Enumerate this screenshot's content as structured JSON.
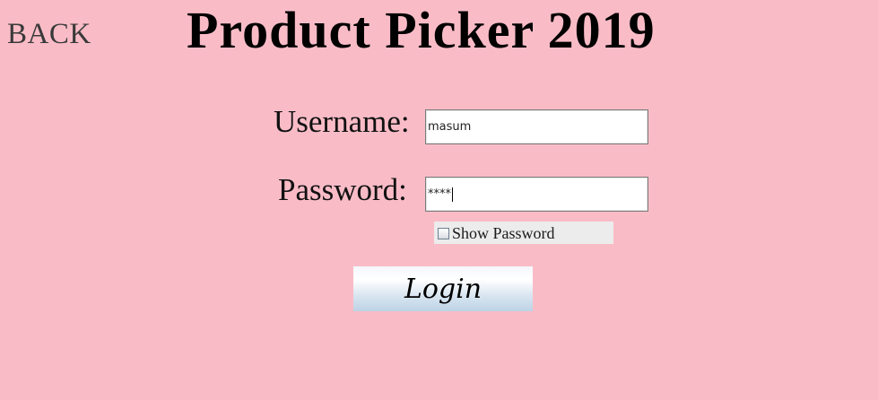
{
  "nav": {
    "back_label": "BACK"
  },
  "header": {
    "title": "Product Picker 2019"
  },
  "form": {
    "username_label": "Username:",
    "username_value": "masum",
    "password_label": "Password:",
    "password_value": "****",
    "show_password_label": "Show Password",
    "show_password_checked": false,
    "login_label": "Login"
  },
  "colors": {
    "background": "#f9bcc7",
    "button_gradient_top": "#ffffff",
    "button_gradient_bottom": "#bdd3e6"
  }
}
